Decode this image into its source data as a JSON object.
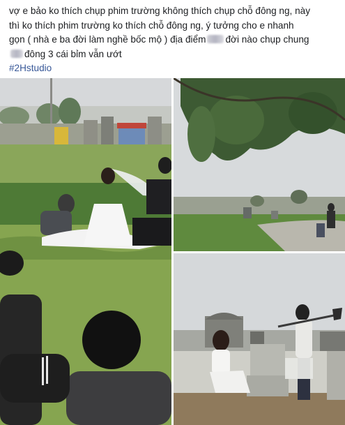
{
  "post": {
    "text_line1": "vợ e bảo ko thích chụp phim trường không thích chụp chỗ đông ng, này",
    "text_line2": "thì ko thích phim trường ko thích chỗ đông ng, ý tưởng cho e nhanh",
    "text_line3_a": "gọn ( nhà e ba đời làm nghề bốc mộ ) địa điểm",
    "text_line3_b": "đời nào chụp chung",
    "text_line4": "đông 3 cái bỉm vẫn ướt",
    "hashtag": "#2Hstudio"
  },
  "photos": [
    {
      "name": "photo-couple-field",
      "description": "couple posing in grass near tombs"
    },
    {
      "name": "photo-tree-cemetery",
      "description": "tree branches over cemetery path"
    },
    {
      "name": "photo-bride-shovel",
      "description": "bride sitting on tomb with shovel holder"
    }
  ],
  "colors": {
    "text": "#1c1e21",
    "hashtag": "#385898",
    "background": "#ffffff"
  }
}
